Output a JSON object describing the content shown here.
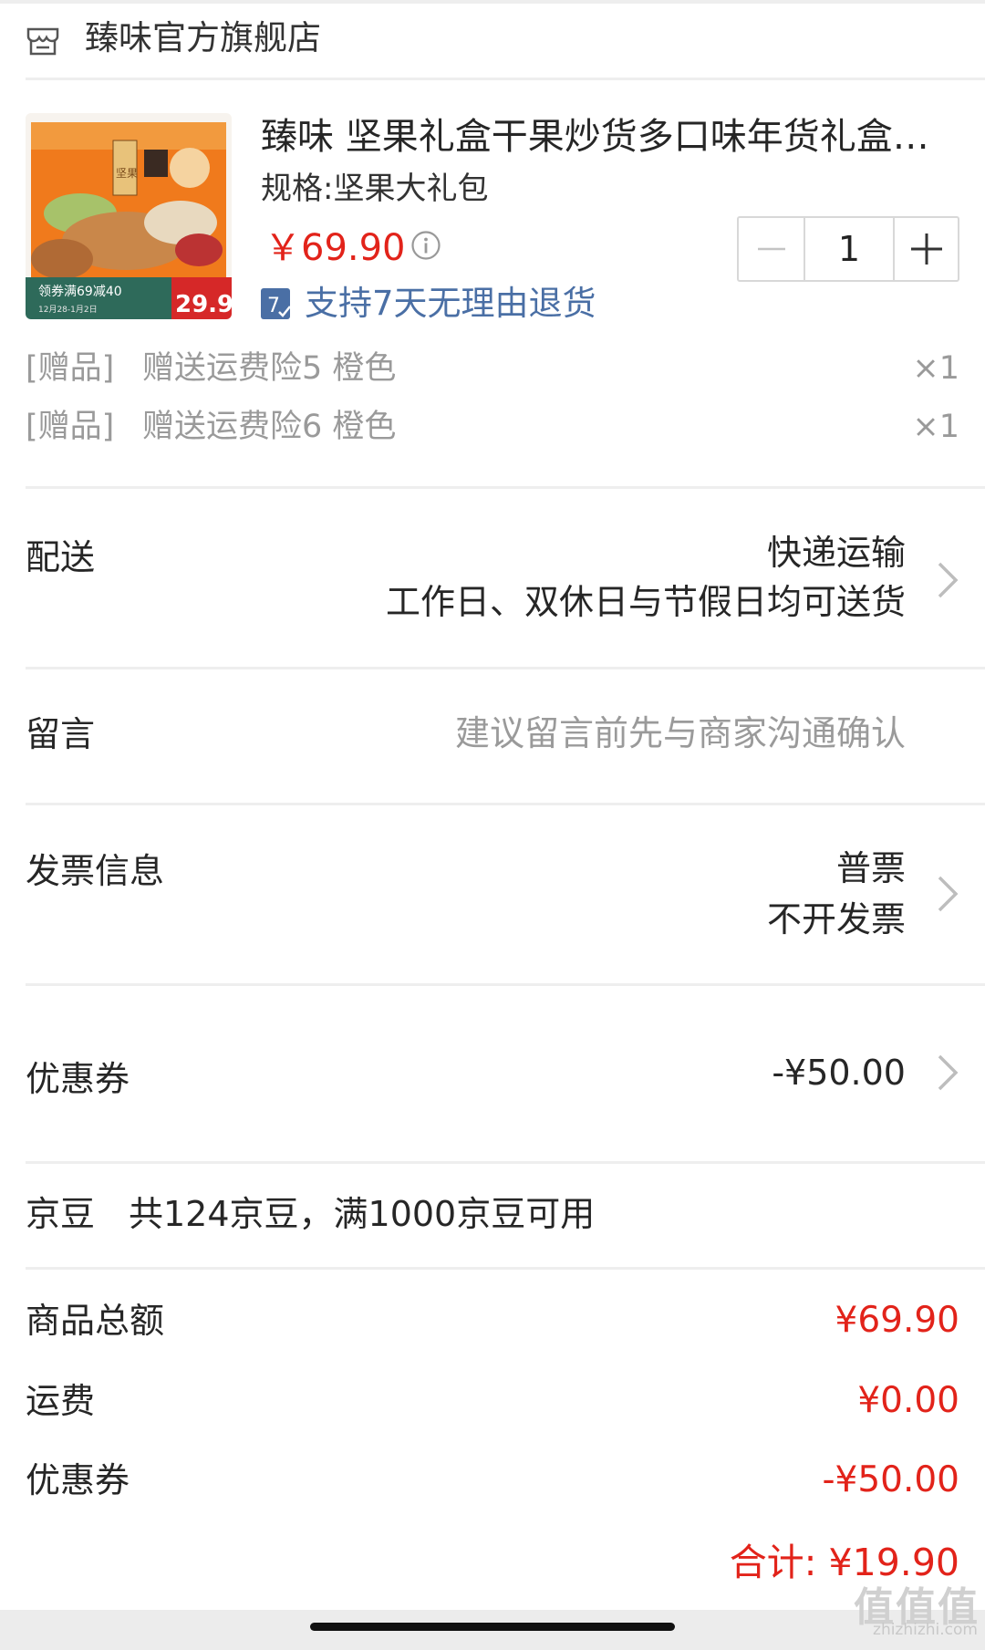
{
  "store": {
    "name": "臻味官方旗舰店",
    "icon": "store-icon"
  },
  "product": {
    "title": "臻味 坚果礼盒干果炒货多口味年货礼盒零…",
    "spec": "规格:坚果大礼包",
    "price": "￥69.90",
    "quantity": "1",
    "return_badge": "7",
    "return_policy": "支持7天无理由退货",
    "thumb_text": {
      "coupon": "领券满69减40",
      "date": "12月28-1月2日",
      "price": "29.9",
      "box_label": "坚果"
    }
  },
  "gifts": [
    {
      "tag": "[赠品]",
      "name": "赠送运费险5 橙色",
      "qty": "×1"
    },
    {
      "tag": "[赠品]",
      "name": "赠送运费险6 橙色",
      "qty": "×1"
    }
  ],
  "delivery": {
    "label": "配送",
    "method": "快递运输",
    "schedule": "工作日、双休日与节假日均可送货"
  },
  "message": {
    "label": "留言",
    "placeholder": "建议留言前先与商家沟通确认"
  },
  "invoice": {
    "label": "发票信息",
    "type": "普票",
    "status": "不开发票"
  },
  "coupon": {
    "label": "优惠券",
    "value": "-¥50.00"
  },
  "jingdou": {
    "label": "京豆",
    "info": "共124京豆，满1000京豆可用"
  },
  "summary": [
    {
      "label": "商品总额",
      "value": "¥69.90"
    },
    {
      "label": "运费",
      "value": "¥0.00"
    },
    {
      "label": "优惠券",
      "value": "-¥50.00"
    }
  ],
  "total": "合计: ¥19.90",
  "watermark": {
    "main": "值值值",
    "sub": "zhizhizhi.com"
  },
  "colors": {
    "price_red": "#e2231a",
    "link_blue": "#4a6fa5",
    "muted": "#9a9a9a"
  }
}
